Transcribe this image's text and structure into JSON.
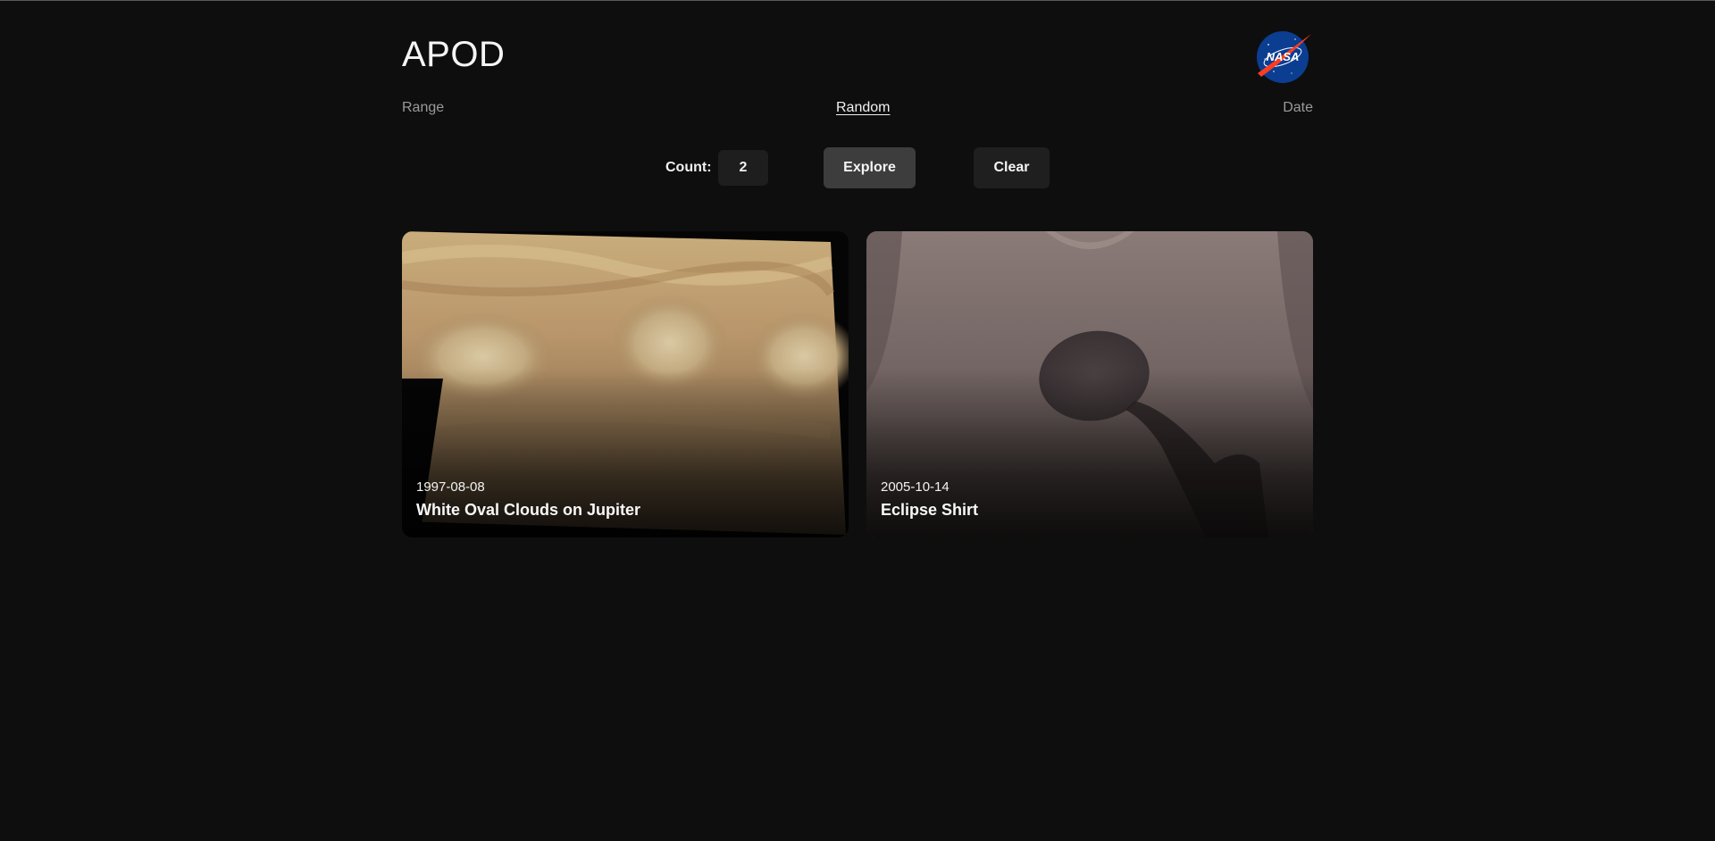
{
  "app": {
    "title": "APOD",
    "logo_text": "NASA"
  },
  "nav": {
    "items": [
      {
        "label": "Range",
        "active": false
      },
      {
        "label": "Random",
        "active": true
      },
      {
        "label": "Date",
        "active": false
      }
    ]
  },
  "controls": {
    "count_label": "Count:",
    "count_value": "2",
    "explore_label": "Explore",
    "clear_label": "Clear"
  },
  "cards": [
    {
      "date": "1997-08-08",
      "title": "White Oval Clouds on Jupiter",
      "image": "jupiter-clouds-photo"
    },
    {
      "date": "2005-10-14",
      "title": "Eclipse Shirt",
      "image": "eclipse-shirt-photo"
    }
  ],
  "colors": {
    "background": "#0e0e0e",
    "explore_button": "#3d3d3d",
    "clear_button": "#1f1f1f",
    "logo_blue": "#0b3d91",
    "logo_red": "#fc3d21"
  }
}
